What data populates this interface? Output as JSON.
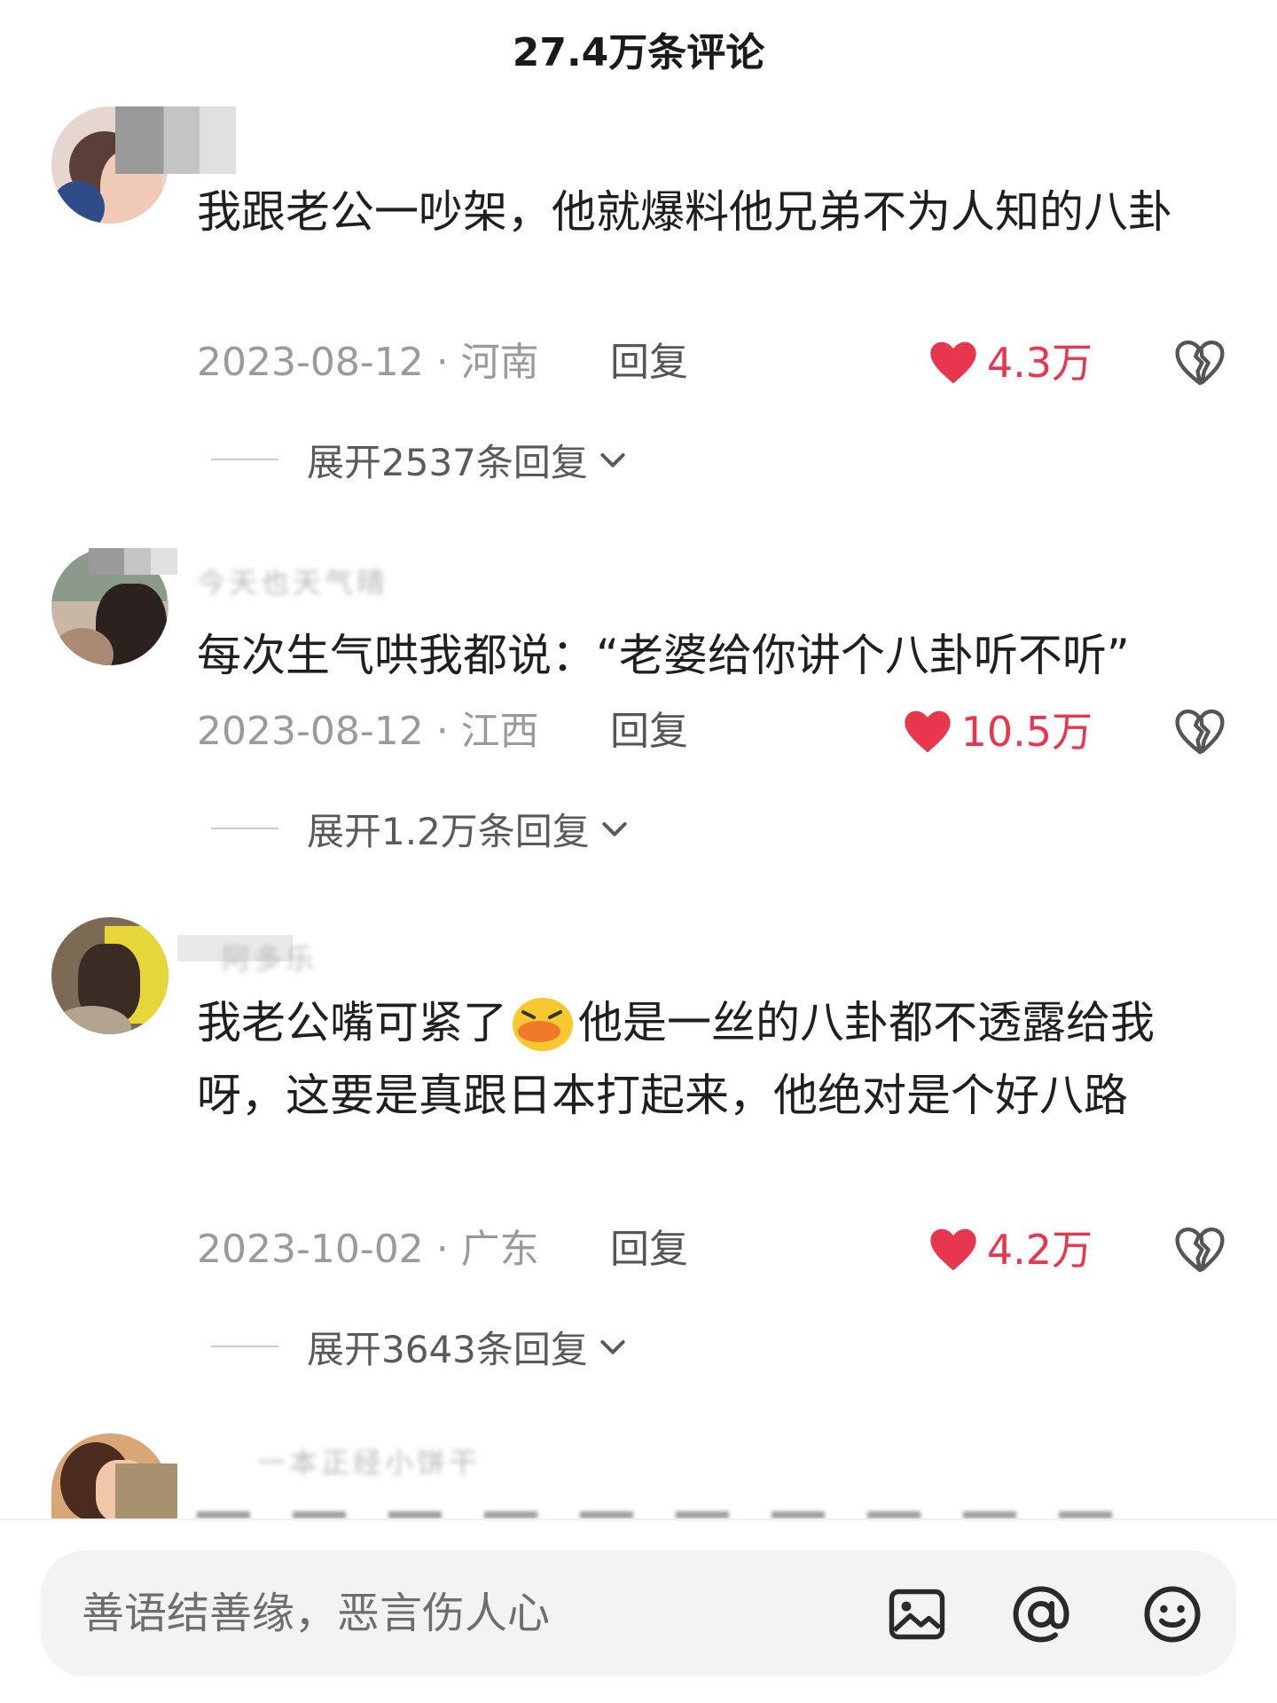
{
  "header": {
    "title": "27.4万条评论"
  },
  "comments": [
    {
      "text": "我跟老公一吵架，他就爆料他兄弟不为人知的八卦",
      "date_location": "2023-08-12 · 河南",
      "reply_label": "回复",
      "likes": "4.3万",
      "expand_label": "展开2537条回复"
    },
    {
      "username": "今天也天气晴",
      "text": "每次生气哄我都说：“老婆给你讲个八卦听不听”",
      "date_location": "2023-08-12 · 江西",
      "reply_label": "回复",
      "likes": "10.5万",
      "expand_label": "展开1.2万条回复"
    },
    {
      "username": "阿多乐",
      "text_before_emoji": "我老公嘴可紧了",
      "text_after_emoji": "他是一丝的八卦都不透露给我呀，这要是真跟日本打起来，他绝对是个好八路",
      "date_location": "2023-10-02 · 广东",
      "reply_label": "回复",
      "likes": "4.2万",
      "expand_label": "展开3643条回复"
    },
    {
      "username": "一本正经小饼干"
    }
  ],
  "input": {
    "placeholder": "善语结善缘，恶言伤人心"
  },
  "icons": {
    "like": "heart-icon",
    "dislike": "broken-heart-icon",
    "expand": "chevron-down-icon",
    "image": "image-icon",
    "mention": "at-icon",
    "emoji": "smiley-icon"
  },
  "colors": {
    "like_accent": "#e8364f",
    "meta_text": "#9a9a9a"
  }
}
